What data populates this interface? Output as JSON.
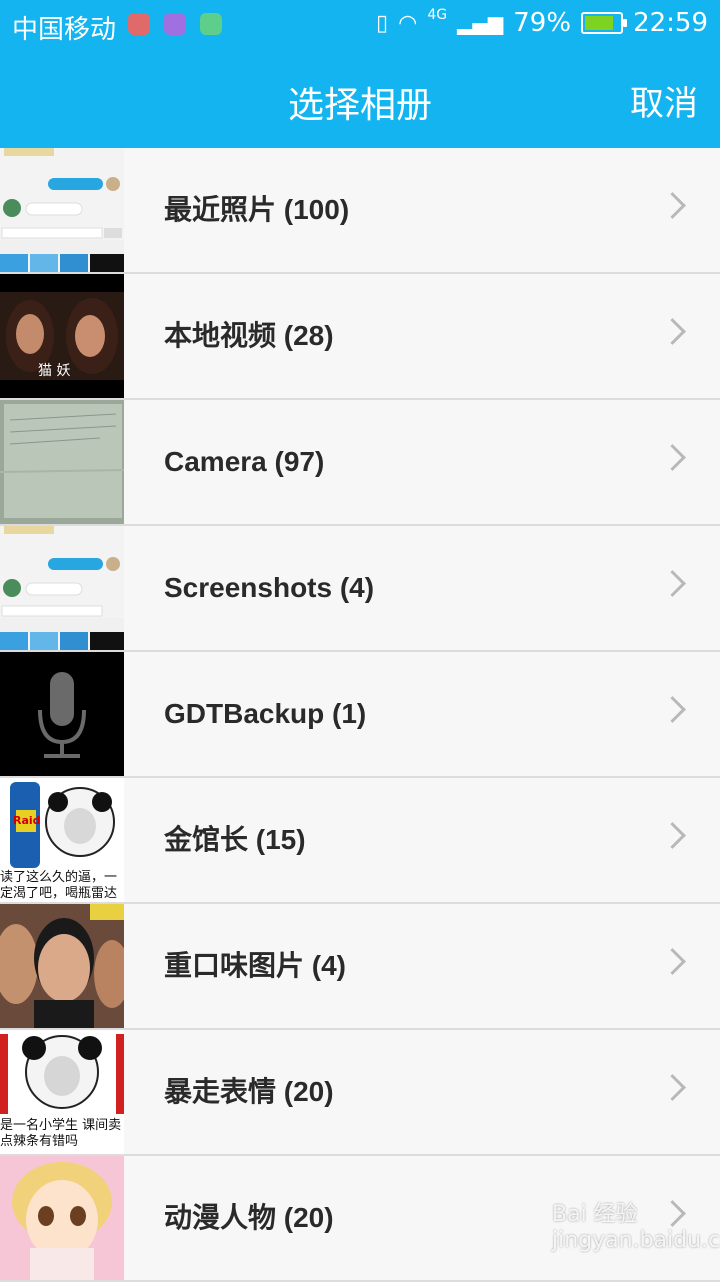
{
  "status_bar": {
    "carrier": "中国移动",
    "network": "4G",
    "battery_percent": "79%",
    "time": "22:59"
  },
  "header": {
    "title": "选择相册",
    "cancel_label": "取消"
  },
  "albums": [
    {
      "label": "最近照片 (100)"
    },
    {
      "label": "本地视频 (28)"
    },
    {
      "label": "Camera (97)"
    },
    {
      "label": "Screenshots (4)"
    },
    {
      "label": "GDTBackup (1)"
    },
    {
      "label": "金馆长 (15)"
    },
    {
      "label": "重口味图片 (4)"
    },
    {
      "label": "暴走表情 (20)"
    },
    {
      "label": "动漫人物 (20)"
    }
  ],
  "thumb_texts": {
    "video_caption": "猫 妖",
    "jinguanzhang_caption": "读了这么久的逼，一定渴了吧，喝瓶雷达吧",
    "baozou_caption": "是一名小学生 课间卖点辣条有错吗",
    "raid_brand": "Raid"
  },
  "watermark": "Bai 经验 jingyan.baidu.com"
}
